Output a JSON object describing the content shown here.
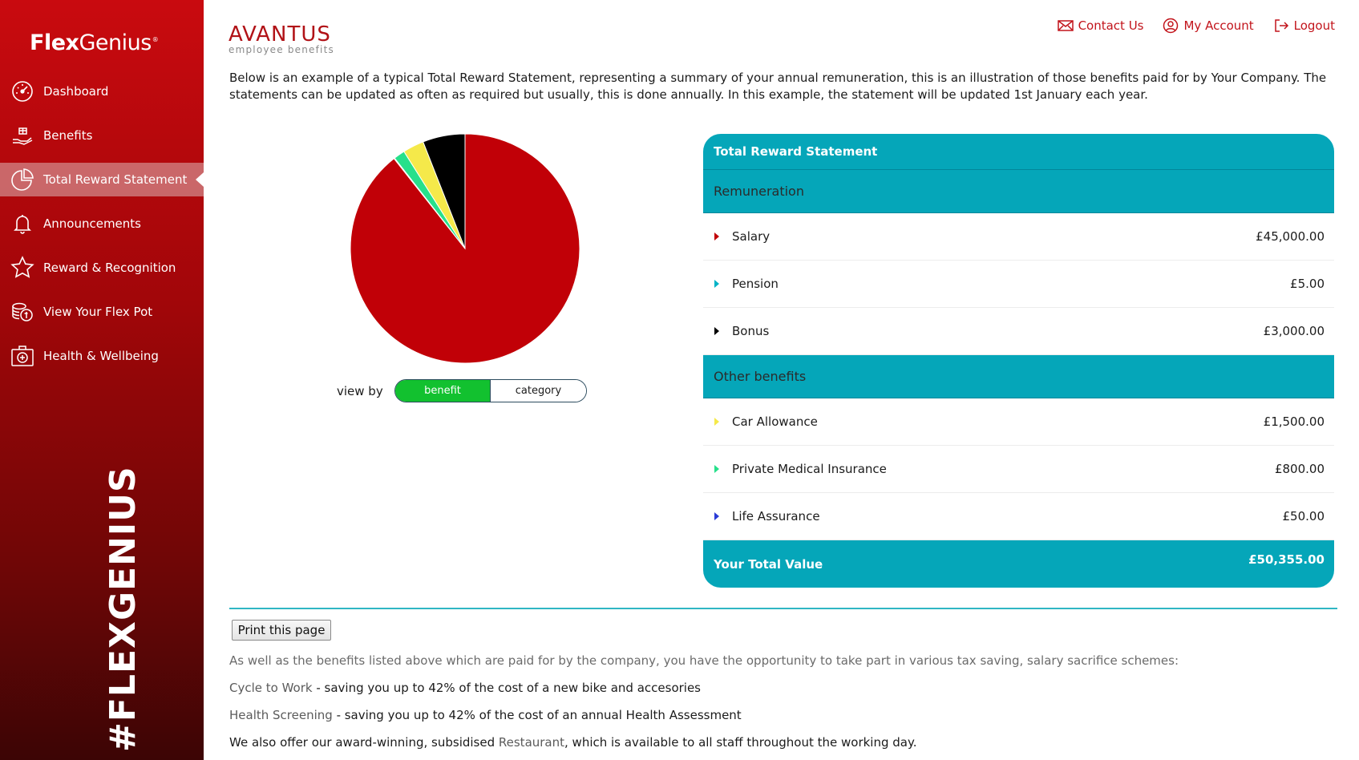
{
  "sidebar": {
    "brand_bold": "Flex",
    "brand_regular": "Genius",
    "brand_mark": "®",
    "tagline": "#FLEXGENIUS",
    "items": [
      {
        "label": "Dashboard",
        "icon": "gauge-icon"
      },
      {
        "label": "Benefits",
        "icon": "hand-gift-icon"
      },
      {
        "label": "Total Reward Statement",
        "icon": "pie-chart-icon",
        "active": true
      },
      {
        "label": "Announcements",
        "icon": "bell-icon"
      },
      {
        "label": "Reward & Recognition",
        "icon": "star-icon"
      },
      {
        "label": "View Your Flex Pot",
        "icon": "coins-icon"
      },
      {
        "label": "Health & Wellbeing",
        "icon": "medical-kit-icon"
      }
    ]
  },
  "header": {
    "logo": "AVANTUS",
    "logo_sub": "employee benefits",
    "contact": "Contact Us",
    "account": "My Account",
    "logout": "Logout"
  },
  "intro": "Below is an example of a typical Total Reward Statement, representing a summary of your annual remuneration, this is an illustration of those benefits paid for by Your Company.  The statements can be updated as often as required but usually, this is done annually. In this example, the statement will be updated 1st January each year.",
  "chart_data": {
    "type": "pie",
    "slices": [
      {
        "label": "Salary",
        "value": 45000,
        "color": "#c10007"
      },
      {
        "label": "Pension",
        "value": 5,
        "color": "#00b3c7"
      },
      {
        "label": "Bonus",
        "value": 3000,
        "color": "#000000"
      },
      {
        "label": "Car Allowance",
        "value": 1500,
        "color": "#f5e94a"
      },
      {
        "label": "Private Medical Insurance",
        "value": 800,
        "color": "#27e08b"
      },
      {
        "label": "Life Assurance",
        "value": 50,
        "color": "#2a3bd6"
      }
    ]
  },
  "viewby": {
    "label": "view by",
    "option_benefit": "benefit",
    "option_category": "category",
    "selected": "benefit"
  },
  "statement": {
    "title": "Total Reward Statement",
    "remuneration_title": "Remuneration",
    "remuneration": [
      {
        "label": "Salary",
        "value": "£45,000.00",
        "color": "#c10007"
      },
      {
        "label": "Pension",
        "value": "£5.00",
        "color": "#00b3c7"
      },
      {
        "label": "Bonus",
        "value": "£3,000.00",
        "color": "#000000"
      }
    ],
    "other_title": "Other benefits",
    "other": [
      {
        "label": "Car Allowance",
        "value": "£1,500.00",
        "color": "#f5e94a"
      },
      {
        "label": "Private Medical Insurance",
        "value": "£800.00",
        "color": "#27e08b"
      },
      {
        "label": "Life Assurance",
        "value": "£50.00",
        "color": "#2a3bd6"
      }
    ],
    "total_label": "Your Total Value",
    "total_value": "£50,355.00"
  },
  "footer": {
    "print_label": "Print this page",
    "schemes_intro": "As well as the benefits listed above which are paid for by the company, you have the opportunity to take part in various tax saving, salary sacrifice schemes:",
    "cycle_link": "Cycle to Work",
    "cycle_text": " - saving you up to 42% of the cost of a new bike and accesories",
    "health_link": "Health Screening",
    "health_text": " - saving you up to 42% of the cost of an annual Health Assessment",
    "restaurant_pre": "We also offer our award-winning, subsidised ",
    "restaurant_link": "Restaurant",
    "restaurant_post": ", which is available to all staff throughout the working day."
  }
}
